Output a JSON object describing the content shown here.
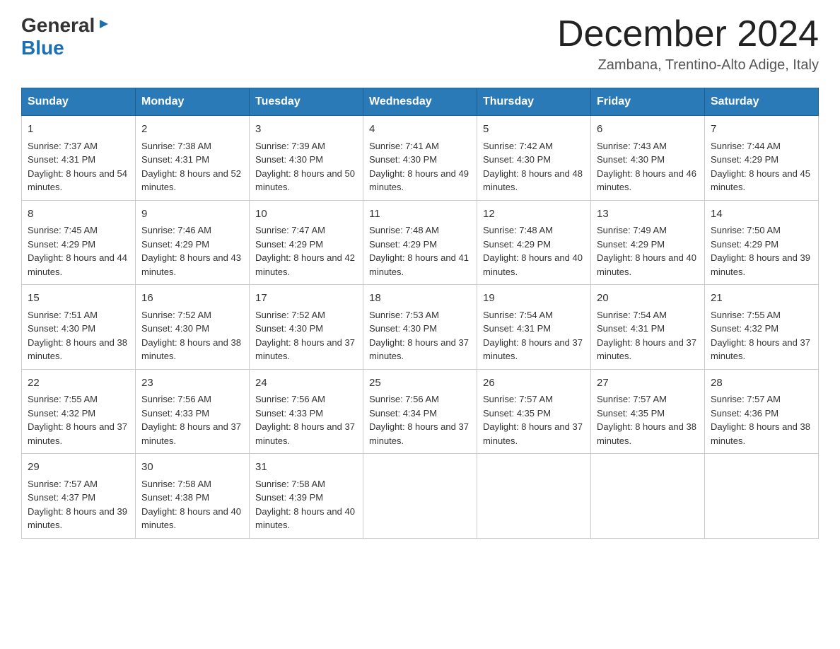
{
  "header": {
    "logo_general": "General",
    "logo_blue": "Blue",
    "month_year": "December 2024",
    "location": "Zambana, Trentino-Alto Adige, Italy"
  },
  "days_of_week": [
    "Sunday",
    "Monday",
    "Tuesday",
    "Wednesday",
    "Thursday",
    "Friday",
    "Saturday"
  ],
  "weeks": [
    [
      {
        "day": "1",
        "sunrise": "Sunrise: 7:37 AM",
        "sunset": "Sunset: 4:31 PM",
        "daylight": "Daylight: 8 hours and 54 minutes."
      },
      {
        "day": "2",
        "sunrise": "Sunrise: 7:38 AM",
        "sunset": "Sunset: 4:31 PM",
        "daylight": "Daylight: 8 hours and 52 minutes."
      },
      {
        "day": "3",
        "sunrise": "Sunrise: 7:39 AM",
        "sunset": "Sunset: 4:30 PM",
        "daylight": "Daylight: 8 hours and 50 minutes."
      },
      {
        "day": "4",
        "sunrise": "Sunrise: 7:41 AM",
        "sunset": "Sunset: 4:30 PM",
        "daylight": "Daylight: 8 hours and 49 minutes."
      },
      {
        "day": "5",
        "sunrise": "Sunrise: 7:42 AM",
        "sunset": "Sunset: 4:30 PM",
        "daylight": "Daylight: 8 hours and 48 minutes."
      },
      {
        "day": "6",
        "sunrise": "Sunrise: 7:43 AM",
        "sunset": "Sunset: 4:30 PM",
        "daylight": "Daylight: 8 hours and 46 minutes."
      },
      {
        "day": "7",
        "sunrise": "Sunrise: 7:44 AM",
        "sunset": "Sunset: 4:29 PM",
        "daylight": "Daylight: 8 hours and 45 minutes."
      }
    ],
    [
      {
        "day": "8",
        "sunrise": "Sunrise: 7:45 AM",
        "sunset": "Sunset: 4:29 PM",
        "daylight": "Daylight: 8 hours and 44 minutes."
      },
      {
        "day": "9",
        "sunrise": "Sunrise: 7:46 AM",
        "sunset": "Sunset: 4:29 PM",
        "daylight": "Daylight: 8 hours and 43 minutes."
      },
      {
        "day": "10",
        "sunrise": "Sunrise: 7:47 AM",
        "sunset": "Sunset: 4:29 PM",
        "daylight": "Daylight: 8 hours and 42 minutes."
      },
      {
        "day": "11",
        "sunrise": "Sunrise: 7:48 AM",
        "sunset": "Sunset: 4:29 PM",
        "daylight": "Daylight: 8 hours and 41 minutes."
      },
      {
        "day": "12",
        "sunrise": "Sunrise: 7:48 AM",
        "sunset": "Sunset: 4:29 PM",
        "daylight": "Daylight: 8 hours and 40 minutes."
      },
      {
        "day": "13",
        "sunrise": "Sunrise: 7:49 AM",
        "sunset": "Sunset: 4:29 PM",
        "daylight": "Daylight: 8 hours and 40 minutes."
      },
      {
        "day": "14",
        "sunrise": "Sunrise: 7:50 AM",
        "sunset": "Sunset: 4:29 PM",
        "daylight": "Daylight: 8 hours and 39 minutes."
      }
    ],
    [
      {
        "day": "15",
        "sunrise": "Sunrise: 7:51 AM",
        "sunset": "Sunset: 4:30 PM",
        "daylight": "Daylight: 8 hours and 38 minutes."
      },
      {
        "day": "16",
        "sunrise": "Sunrise: 7:52 AM",
        "sunset": "Sunset: 4:30 PM",
        "daylight": "Daylight: 8 hours and 38 minutes."
      },
      {
        "day": "17",
        "sunrise": "Sunrise: 7:52 AM",
        "sunset": "Sunset: 4:30 PM",
        "daylight": "Daylight: 8 hours and 37 minutes."
      },
      {
        "day": "18",
        "sunrise": "Sunrise: 7:53 AM",
        "sunset": "Sunset: 4:30 PM",
        "daylight": "Daylight: 8 hours and 37 minutes."
      },
      {
        "day": "19",
        "sunrise": "Sunrise: 7:54 AM",
        "sunset": "Sunset: 4:31 PM",
        "daylight": "Daylight: 8 hours and 37 minutes."
      },
      {
        "day": "20",
        "sunrise": "Sunrise: 7:54 AM",
        "sunset": "Sunset: 4:31 PM",
        "daylight": "Daylight: 8 hours and 37 minutes."
      },
      {
        "day": "21",
        "sunrise": "Sunrise: 7:55 AM",
        "sunset": "Sunset: 4:32 PM",
        "daylight": "Daylight: 8 hours and 37 minutes."
      }
    ],
    [
      {
        "day": "22",
        "sunrise": "Sunrise: 7:55 AM",
        "sunset": "Sunset: 4:32 PM",
        "daylight": "Daylight: 8 hours and 37 minutes."
      },
      {
        "day": "23",
        "sunrise": "Sunrise: 7:56 AM",
        "sunset": "Sunset: 4:33 PM",
        "daylight": "Daylight: 8 hours and 37 minutes."
      },
      {
        "day": "24",
        "sunrise": "Sunrise: 7:56 AM",
        "sunset": "Sunset: 4:33 PM",
        "daylight": "Daylight: 8 hours and 37 minutes."
      },
      {
        "day": "25",
        "sunrise": "Sunrise: 7:56 AM",
        "sunset": "Sunset: 4:34 PM",
        "daylight": "Daylight: 8 hours and 37 minutes."
      },
      {
        "day": "26",
        "sunrise": "Sunrise: 7:57 AM",
        "sunset": "Sunset: 4:35 PM",
        "daylight": "Daylight: 8 hours and 37 minutes."
      },
      {
        "day": "27",
        "sunrise": "Sunrise: 7:57 AM",
        "sunset": "Sunset: 4:35 PM",
        "daylight": "Daylight: 8 hours and 38 minutes."
      },
      {
        "day": "28",
        "sunrise": "Sunrise: 7:57 AM",
        "sunset": "Sunset: 4:36 PM",
        "daylight": "Daylight: 8 hours and 38 minutes."
      }
    ],
    [
      {
        "day": "29",
        "sunrise": "Sunrise: 7:57 AM",
        "sunset": "Sunset: 4:37 PM",
        "daylight": "Daylight: 8 hours and 39 minutes."
      },
      {
        "day": "30",
        "sunrise": "Sunrise: 7:58 AM",
        "sunset": "Sunset: 4:38 PM",
        "daylight": "Daylight: 8 hours and 40 minutes."
      },
      {
        "day": "31",
        "sunrise": "Sunrise: 7:58 AM",
        "sunset": "Sunset: 4:39 PM",
        "daylight": "Daylight: 8 hours and 40 minutes."
      },
      null,
      null,
      null,
      null
    ]
  ]
}
